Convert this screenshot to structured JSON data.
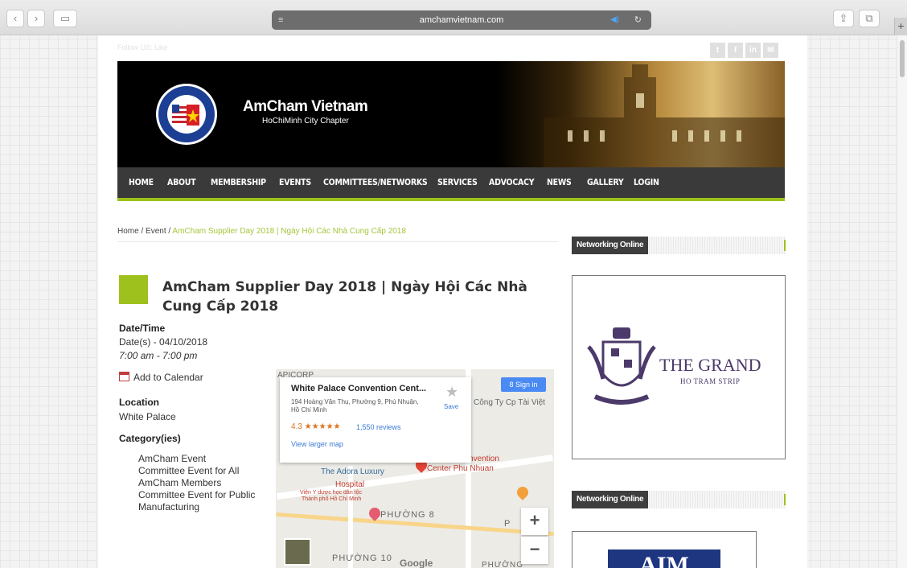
{
  "browser": {
    "url": "amchamvietnam.com",
    "back_glyph": "‹",
    "forward_glyph": "›",
    "sidebar_glyph": "▭",
    "reader_glyph": "≡",
    "speaker_glyph": "◀)",
    "reload_glyph": "↻",
    "share_glyph": "⇪",
    "tabs_glyph": "⧉",
    "newtab_glyph": "+"
  },
  "site": {
    "top_text": "Follow US: Like",
    "social": [
      "t",
      "f",
      "in",
      "✉"
    ],
    "banner_title": "AmCham Vietnam",
    "banner_subtitle": "HoChiMinh City Chapter",
    "nav": [
      "HOME",
      "ABOUT",
      "MEMBERSHIP",
      "EVENTS",
      "COMMITTEES/NETWORKS",
      "SERVICES",
      "ADVOCACY",
      "NEWS",
      "GALLERY",
      "LOGIN"
    ]
  },
  "breadcrumb": {
    "home": "Home",
    "sep": " / ",
    "event": "Event",
    "current": "AmCham Supplier Day 2018 | Ngày Hội Các Nhà Cung Cấp 2018"
  },
  "event": {
    "title": "AmCham Supplier Day 2018 | Ngày Hội Các Nhà Cung Cấp 2018",
    "datetime_label": "Date/Time",
    "dates": "Date(s) - 04/10/2018",
    "time": "7:00 am - 7:00 pm",
    "add_calendar": "Add to Calendar",
    "location_label": "Location",
    "location": "White Palace",
    "category_label": "Category(ies)",
    "categories": [
      "AmCham Event",
      "Committee Event for All",
      "AmCham Members",
      "Committee Event for Public",
      "Manufacturing"
    ]
  },
  "map": {
    "place_name": "White Palace Convention Cent...",
    "address": "194 Hoàng Văn Thụ, Phường 9, Phú Nhuận, Hồ Chí Minh",
    "save": "Save",
    "rating": "4.3 ★★★★★",
    "reviews": "1,550 reviews",
    "larger_map": "View larger map",
    "sign_in": "Sign in",
    "labels": {
      "apicorp": "APICORP",
      "company": "Công Ty Cp Tài Việt",
      "convention": "ce Convention",
      "center": "Center Phu Nhuan",
      "adora": "The Adora Luxury",
      "hospital": "Hospital",
      "hospital_vi_1": "Viện Y dược học dân tộc",
      "hospital_vi_2": "Thành phố Hồ Chí Minh",
      "phuong8": "PHƯỜNG 8",
      "phuong10": "PHƯỜNG 10",
      "phuong_right": "PHƯỜNG",
      "p": "P",
      "google": "Google"
    },
    "zoom_in": "+",
    "zoom_out": "−"
  },
  "sidebar": {
    "heading1": "Networking Online",
    "heading2": "Networking Online",
    "ad1_title": "THE GRAND",
    "ad1_sub": "HO TRAM STRIP",
    "ad2_title": "AIM"
  },
  "colors": {
    "accent_green": "#9ec11e",
    "nav_bg": "#3a3a3a",
    "link_blue": "#3a7bd5"
  }
}
